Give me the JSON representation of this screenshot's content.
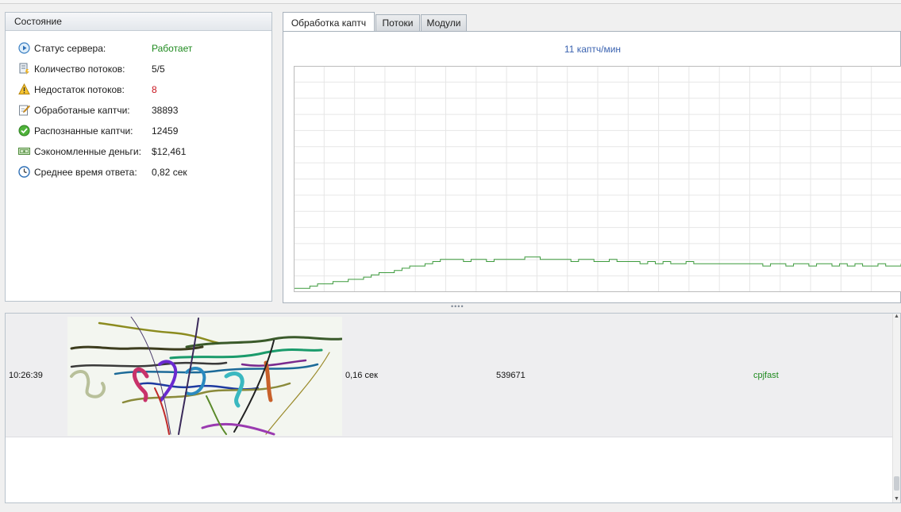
{
  "status": {
    "title": "Состояние",
    "rows": [
      {
        "icon": "play-circle-icon",
        "label": "Статус сервера:",
        "value": "Работает",
        "color": "green"
      },
      {
        "icon": "threads-icon",
        "label": "Количество потоков:",
        "value": "5/5",
        "color": "normal"
      },
      {
        "icon": "warning-icon",
        "label": "Недостаток потоков:",
        "value": "8",
        "color": "red"
      },
      {
        "icon": "edit-note-icon",
        "label": "Обработаные каптчи:",
        "value": "38893",
        "color": "normal"
      },
      {
        "icon": "check-circle-icon",
        "label": "Распознанные каптчи:",
        "value": "12459",
        "color": "normal"
      },
      {
        "icon": "money-icon",
        "label": "Сэкономленные деньги:",
        "value": "$12,461",
        "color": "normal"
      },
      {
        "icon": "clock-icon",
        "label": "Среднее время ответа:",
        "value": "0,82 сек",
        "color": "normal"
      }
    ]
  },
  "tabs": [
    {
      "label": "Обработка каптч",
      "active": true
    },
    {
      "label": "Потоки",
      "active": false
    },
    {
      "label": "Модули",
      "active": false
    }
  ],
  "chart": {
    "title": "11 каптч/мин",
    "line_color": "#3c9a3c",
    "grid_color": "#e6e6e6"
  },
  "chart_data": {
    "type": "line",
    "title": "11 каптч/мин",
    "xlabel": "",
    "ylabel": "",
    "ylim": [
      0,
      100
    ],
    "grid": true,
    "series": [
      {
        "values": [
          1,
          1,
          2,
          3,
          3,
          4,
          4,
          5,
          5,
          6,
          7,
          8,
          8,
          9,
          10,
          11,
          11,
          12,
          13,
          14,
          14,
          14,
          13,
          14,
          14,
          13,
          14,
          14,
          14,
          14,
          15,
          15,
          14,
          14,
          14,
          14,
          13,
          14,
          14,
          13,
          13,
          14,
          13,
          13,
          13,
          12,
          13,
          12,
          13,
          12,
          12,
          13,
          12,
          12,
          12,
          12,
          12,
          12,
          12,
          12,
          12,
          11,
          12,
          12,
          11,
          12,
          12,
          11,
          12,
          12,
          11,
          12,
          11,
          12,
          11,
          11,
          12,
          11,
          11,
          12
        ]
      }
    ]
  },
  "log": {
    "rows": [
      {
        "time": "10:26:39",
        "duration": "0,16 сек",
        "id": "539671",
        "module": "cpjfast"
      }
    ]
  },
  "colors": {
    "green_text": "#1e8a1e",
    "red_text": "#c8141e",
    "chart_title": "#3b63b0",
    "module_text": "#1e8a1e"
  }
}
